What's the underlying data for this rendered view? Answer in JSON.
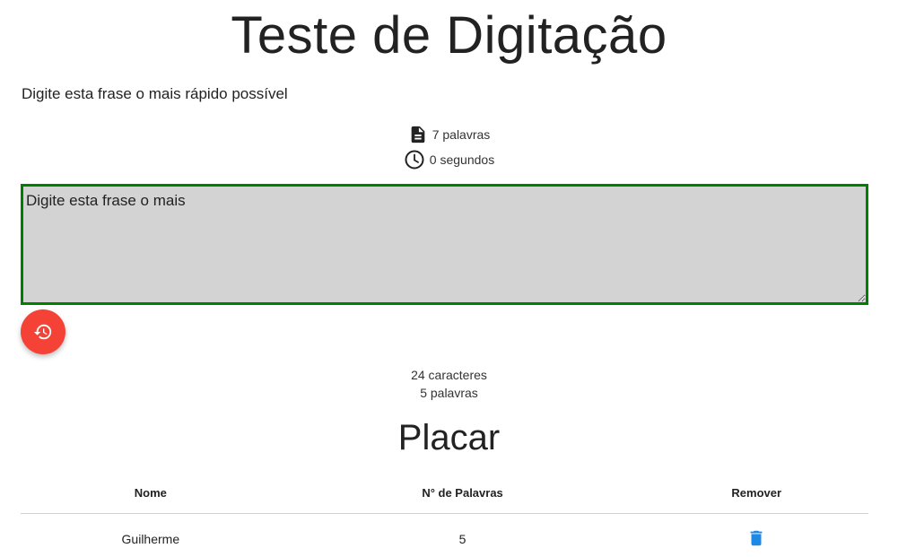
{
  "header": {
    "title": "Teste de Digitação"
  },
  "phrase": {
    "text": "Digite esta frase o mais rápido possível"
  },
  "info": {
    "word_count_label": "7 palavras",
    "time_label": "0 segundos",
    "word_icon": "document-icon",
    "time_icon": "clock-icon"
  },
  "typing": {
    "value": "Digite esta frase o mais",
    "border_color": "#008000",
    "background_color": "#d3d3d3"
  },
  "reset_button": {
    "icon": "restore-history-icon",
    "color": "#f44336"
  },
  "counters": {
    "characters_label": "24 caracteres",
    "words_label": "5 palavras"
  },
  "scoreboard": {
    "title": "Placar",
    "columns": [
      "Nome",
      "N° de Palavras",
      "Remover"
    ],
    "rows": [
      {
        "name": "Guilherme",
        "words": "5",
        "remove_icon": "trash-icon"
      }
    ],
    "remove_icon_color": "#1e88e5"
  }
}
